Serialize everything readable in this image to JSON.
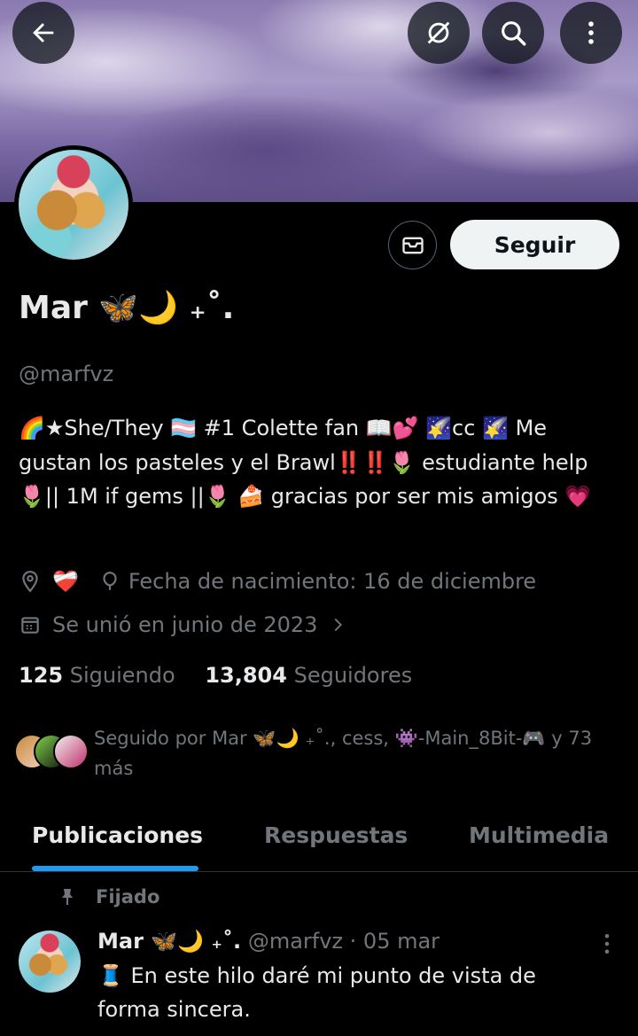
{
  "colors": {
    "background": "#000000",
    "primary_text": "#e7e9ea",
    "secondary_text": "#71767b",
    "accent": "#1d9bf0",
    "follow_button_bg": "#eff3f4"
  },
  "header": {
    "back_icon": "arrow-left-icon",
    "actions": [
      "compass-off-icon",
      "search-icon",
      "more-vertical-icon"
    ]
  },
  "profile": {
    "name": "Mar 🦋🌙 ₊˚.",
    "handle": "@marfvz",
    "follow_label": "Seguir",
    "message_icon": "envelope-icon",
    "bio": "🌈★She/They 🏳️‍⚧️ #1 Colette fan 📖💕  🌠cc 🌠 Me gustan los pasteles y el Brawl‼️‼️🌷 estudiante help🌷|| 1M if gems ||🌷 🍰 gracias por ser mis amigos 💗",
    "location_icon": "location-pin-icon",
    "location": "❤️‍🩹",
    "birthday_icon": "balloon-icon",
    "birthday": "Fecha de nacimiento: 16 de diciembre",
    "joined_icon": "calendar-icon",
    "joined": "Se unió en junio de 2023",
    "following_count": "125",
    "following_label": "Siguiendo",
    "followers_count": "13,804",
    "followers_label": "Seguidores",
    "followed_by": "Seguido por Mar 🦋🌙 ₊˚., cess, 👾-Main_8Bit-🎮 y 73 más"
  },
  "tabs": [
    {
      "label": "Publicaciones",
      "active": true
    },
    {
      "label": "Respuestas",
      "active": false
    },
    {
      "label": "Multimedia",
      "active": false
    }
  ],
  "pinned_post": {
    "pinned_label": "Fijado",
    "author_name": "Mar 🦋🌙 ₊˚.",
    "meta": "@marfvz · 05 mar",
    "text": "🧵 En este hilo daré mi punto de vista de forma sincera."
  }
}
